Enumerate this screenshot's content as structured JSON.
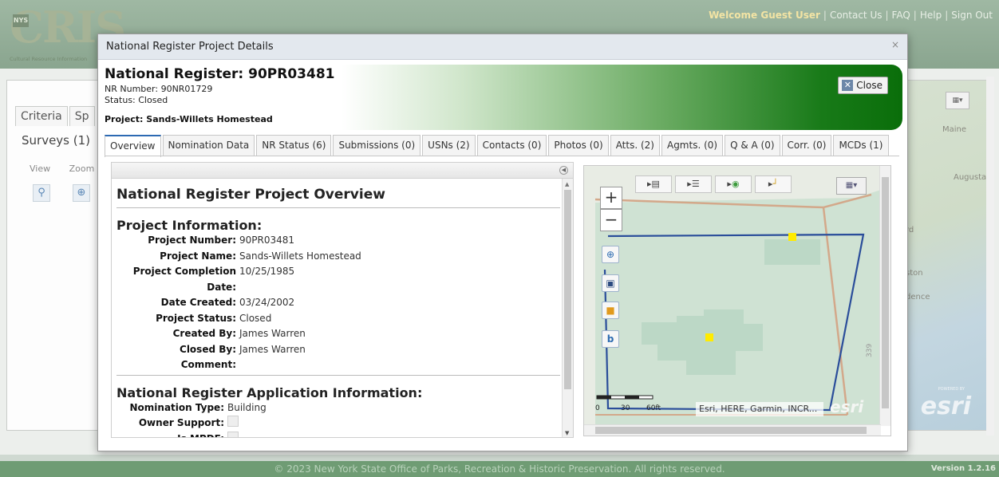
{
  "header": {
    "logo_text": "CRIS",
    "logo_badge": "NYS",
    "logo_subtitle": "Cultural Resource Information",
    "welcome": "Welcome Guest User",
    "links": [
      "Contact Us",
      "FAQ",
      "Help",
      "Sign Out"
    ]
  },
  "background": {
    "tabs": [
      "Criteria",
      "Sp"
    ],
    "surveys_label": "Surveys (1)",
    "col_view": "View",
    "col_zoom": "Zoom",
    "map_labels": {
      "maine": "Maine",
      "augusta": "Augusta",
      "rd": "rd",
      "ston": "ston",
      "dence": "dence"
    },
    "map_powered": "POWERED BY",
    "map_esri": "esri"
  },
  "modal": {
    "title": "National Register Project Details",
    "close_x": "×",
    "nr_title": "National Register: 90PR03481",
    "nr_number": "NR Number: 90NR01729",
    "status": "Status: Closed",
    "project": "Project: Sands-Willets Homestead",
    "close_label": "Close"
  },
  "tabs": [
    {
      "label": "Overview",
      "active": true
    },
    {
      "label": "Nomination Data"
    },
    {
      "label": "NR Status (6)"
    },
    {
      "label": "Submissions (0)"
    },
    {
      "label": "USNs (2)"
    },
    {
      "label": "Contacts (0)"
    },
    {
      "label": "Photos (0)"
    },
    {
      "label": "Atts. (2)"
    },
    {
      "label": "Agmts. (0)"
    },
    {
      "label": "Q & A (0)"
    },
    {
      "label": "Corr. (0)"
    },
    {
      "label": "MCDs (1)"
    }
  ],
  "overview": {
    "heading": "National Register Project Overview",
    "project_info_heading": "Project Information:",
    "project_info": [
      {
        "key": "Project Number:",
        "value": "90PR03481"
      },
      {
        "key": "Project Name:",
        "value": "Sands-Willets Homestead"
      },
      {
        "key": "Project Completion Date:",
        "value": "10/25/1985"
      },
      {
        "key": "Date Created:",
        "value": "03/24/2002"
      },
      {
        "key": "Project Status:",
        "value": "Closed"
      },
      {
        "key": "Created By:",
        "value": "James Warren"
      },
      {
        "key": "Closed By:",
        "value": "James Warren"
      },
      {
        "key": "Comment:",
        "value": ""
      }
    ],
    "app_info_heading": "National Register Application Information:",
    "nomination_type_key": "Nomination Type:",
    "nomination_type_value": "Building",
    "owner_support_key": "Owner Support:",
    "is_mpdf_key": "Is MPDF:"
  },
  "map": {
    "zoom_in": "+",
    "zoom_out": "−",
    "scale_zero": "0",
    "scale_mid": "30",
    "scale_end": "60ft",
    "attribution": "Esri, HERE, Garmin, INCR...",
    "esri_logo": "esri",
    "road_label": "339"
  },
  "footer": {
    "copyright": "© 2023 New York State Office of Parks, Recreation & Historic Preservation. All rights reserved.",
    "version": "Version 1.2.16"
  }
}
